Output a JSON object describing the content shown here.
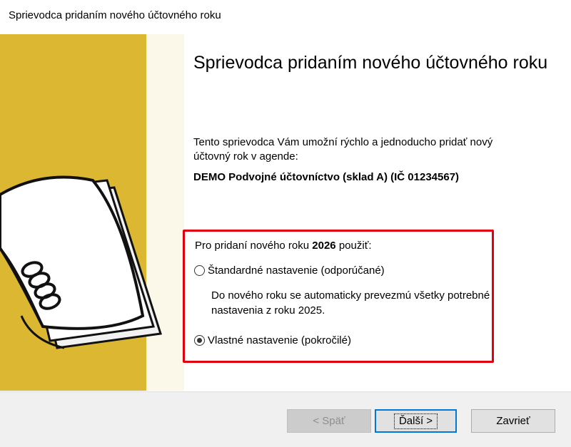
{
  "window": {
    "title": "Sprievodca pridaním nového účtovného roku"
  },
  "main": {
    "heading": "Sprievodca pridaním nového účtovného roku",
    "intro": "Tento sprievodca Vám umožní rýchlo a jednoducho pridať nový účtovný rok v agende:",
    "agenda": "DEMO Podvojné účtovníctvo (sklad A) (IČ 01234567)",
    "question_prefix": "Pro pridaní nového roku",
    "question_year": "2026",
    "question_suffix": "použiť:",
    "options": [
      {
        "label": "Štandardné nastavenie (odporúčané)",
        "checked": false
      },
      {
        "label": "Vlastné nastavenie (pokročilé)",
        "checked": true
      }
    ],
    "standard_description": "Do nového roku se automaticky prevezmú všetky potrebné nastavenia z roku 2025."
  },
  "buttons": {
    "back": "< Späť",
    "next": "Ďalší >",
    "close": "Zavrieť"
  },
  "colors": {
    "highlight_border": "#e2000f",
    "side_accent": "#dbb732",
    "focus_border": "#0078d7"
  },
  "icons": {
    "left_graphic": "notepad-illustration-icon"
  }
}
